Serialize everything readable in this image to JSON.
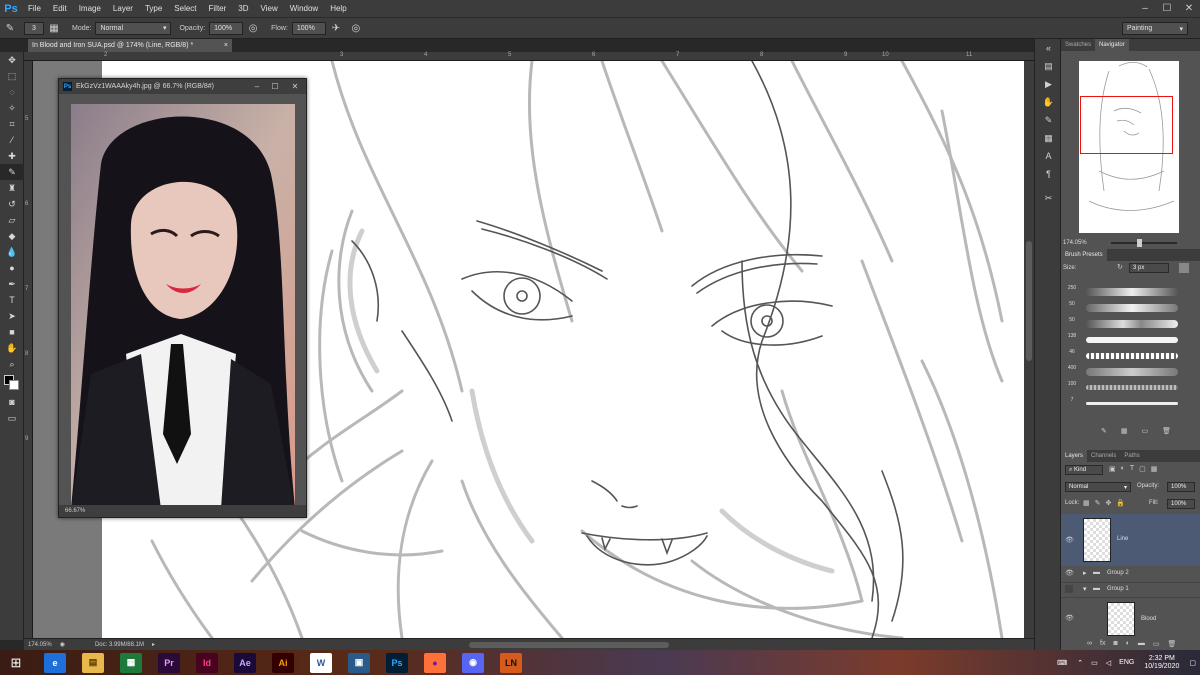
{
  "app": {
    "logo": "Ps",
    "menu": [
      "File",
      "Edit",
      "Image",
      "Layer",
      "Type",
      "Select",
      "Filter",
      "3D",
      "View",
      "Window",
      "Help"
    ],
    "window_controls": [
      "–",
      "☐",
      "✕"
    ]
  },
  "options": {
    "brush_size": "3",
    "mode_label": "Mode:",
    "mode_value": "Normal",
    "opacity_label": "Opacity:",
    "opacity_value": "100%",
    "flow_label": "Flow:",
    "flow_value": "100%",
    "workspace": "Painting"
  },
  "document": {
    "tab_title": "In Blood and Iron SUA.psd @ 174% (Line, RGB/8) *",
    "tab_close": "×",
    "zoom": "174.05%",
    "doc_info": "Doc: 3.99M/88.1M",
    "ruler_h": [
      "2",
      "3",
      "4",
      "5",
      "6",
      "7",
      "8",
      "9",
      "10",
      "11"
    ],
    "ruler_v": [
      "5",
      "6",
      "7",
      "8",
      "9"
    ]
  },
  "reference_window": {
    "title": "EkGzVz1WAAAky4h.jpg @ 66.7% (RGB/8#)",
    "zoom": "66.67%",
    "controls": [
      "–",
      "☐",
      "✕"
    ]
  },
  "panels": {
    "nav_tabs": [
      "Swatches",
      "Navigator"
    ],
    "nav_zoom": "174.05%",
    "brush_tab": "Brush Presets",
    "brush_size_label": "Size:",
    "brush_size_value": "3 px",
    "brushes": [
      "250",
      "50",
      "50",
      "138",
      "46",
      "400",
      "100",
      "7"
    ],
    "layer_tabs": [
      "Layers",
      "Channels",
      "Paths"
    ],
    "kind_label": "Kind",
    "blend_mode": "Normal",
    "opacity_label": "Opacity:",
    "opacity_value": "100%",
    "lock_label": "Lock:",
    "fill_label": "Fill:",
    "fill_value": "100%",
    "layers": [
      {
        "name": "Line",
        "type": "layer",
        "selected": true
      },
      {
        "name": "Group 2",
        "type": "group"
      },
      {
        "name": "Group 1",
        "type": "group"
      },
      {
        "name": "Blood",
        "type": "layer"
      }
    ]
  },
  "taskbar": {
    "apps": [
      {
        "label": "e",
        "bg": "#1e6fd9",
        "fg": "#ffffff"
      },
      {
        "label": "▤",
        "bg": "#e8b84a",
        "fg": "#5a3a00"
      },
      {
        "label": "▦",
        "bg": "#1e7a3c",
        "fg": "#ffffff"
      },
      {
        "label": "Pr",
        "bg": "#2a0a38",
        "fg": "#e39bff"
      },
      {
        "label": "Id",
        "bg": "#49021f",
        "fg": "#ff3d8b"
      },
      {
        "label": "Ae",
        "bg": "#1a0a3a",
        "fg": "#c7a6ff"
      },
      {
        "label": "Ai",
        "bg": "#330000",
        "fg": "#ff9a00"
      },
      {
        "label": "W",
        "bg": "#ffffff",
        "fg": "#2b579a"
      },
      {
        "label": "▣",
        "bg": "#2a5a8a",
        "fg": "#ffffff"
      },
      {
        "label": "Ps",
        "bg": "#001e36",
        "fg": "#31a8ff"
      },
      {
        "label": "●",
        "bg": "#ff7139",
        "fg": "#6a1aa8"
      },
      {
        "label": "◉",
        "bg": "#5865f2",
        "fg": "#ffffff"
      },
      {
        "label": "LN",
        "bg": "#d65a1a",
        "fg": "#111111"
      }
    ],
    "language": "ENG",
    "time": "2:32 PM",
    "date": "10/19/2020"
  }
}
